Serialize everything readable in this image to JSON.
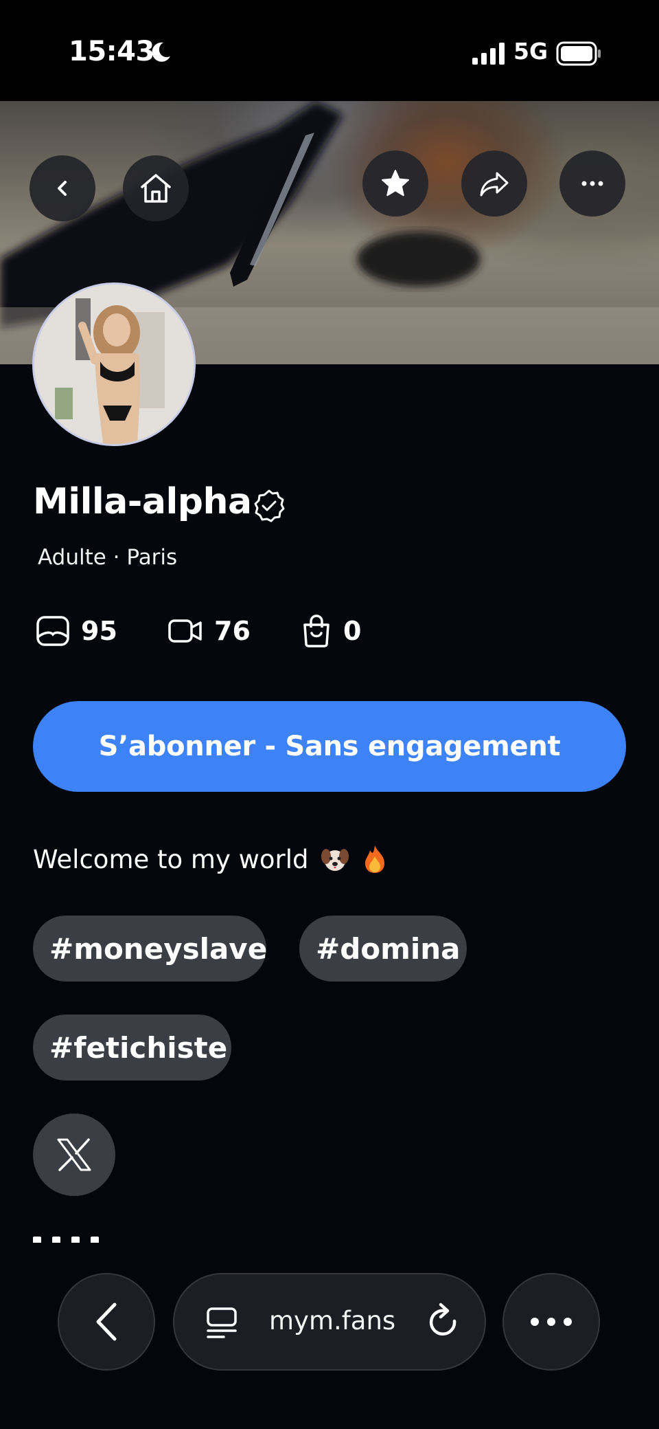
{
  "status_bar": {
    "time": "15:43",
    "network": "5G"
  },
  "profile": {
    "name": "Milla-alpha",
    "subtitle": "Adulte · Paris",
    "stats": {
      "photos": "95",
      "videos": "76",
      "products": "0"
    },
    "subscribe_label": "S’abonner - Sans engagement",
    "bio": "Welcome to my world",
    "tags": [
      "#moneyslave",
      "#domina",
      "#fetichiste"
    ]
  },
  "browser": {
    "url": "mym.fans"
  },
  "colors": {
    "accent": "#3d82f7",
    "background": "#05060c",
    "chip": "#3c3e45"
  }
}
